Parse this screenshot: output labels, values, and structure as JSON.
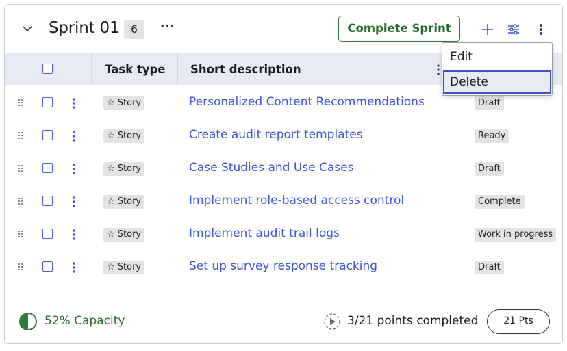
{
  "sprint": {
    "title": "Sprint 01",
    "count": "6",
    "more": "···",
    "complete_label": "Complete Sprint"
  },
  "icons": {
    "collapse": "chevron-down-icon",
    "add": "plus-icon",
    "filter": "settings-sliders-icon",
    "more": "more-vertical-icon"
  },
  "columns": {
    "task_type": "Task type",
    "short_description": "Short description"
  },
  "rows": [
    {
      "type": "☆ Story",
      "description": "Personalized Content Recommendations",
      "state": "Draft"
    },
    {
      "type": "☆ Story",
      "description": "Create audit report templates",
      "state": "Ready"
    },
    {
      "type": "☆ Story",
      "description": "Case Studies and Use Cases",
      "state": "Draft"
    },
    {
      "type": "☆ Story",
      "description": "Implement role-based access control",
      "state": "Complete"
    },
    {
      "type": "☆ Story",
      "description": "Implement audit trail logs",
      "state": "Work in progress"
    },
    {
      "type": "☆ Story",
      "description": "Set up survey response tracking",
      "state": "Draft"
    }
  ],
  "footer": {
    "capacity": "52% Capacity",
    "capacity_fraction": 0.52,
    "points_completed": "3/21 points completed",
    "points_button": "21 Pts"
  },
  "menu": {
    "items": [
      {
        "label": "Edit"
      },
      {
        "label": "Delete"
      }
    ],
    "selected": "Delete"
  },
  "colors": {
    "accent": "#3b54d9",
    "complete_green": "#2e7d32",
    "header_bg": "#e7e9f5",
    "pill_bg": "#e2e3e5"
  }
}
